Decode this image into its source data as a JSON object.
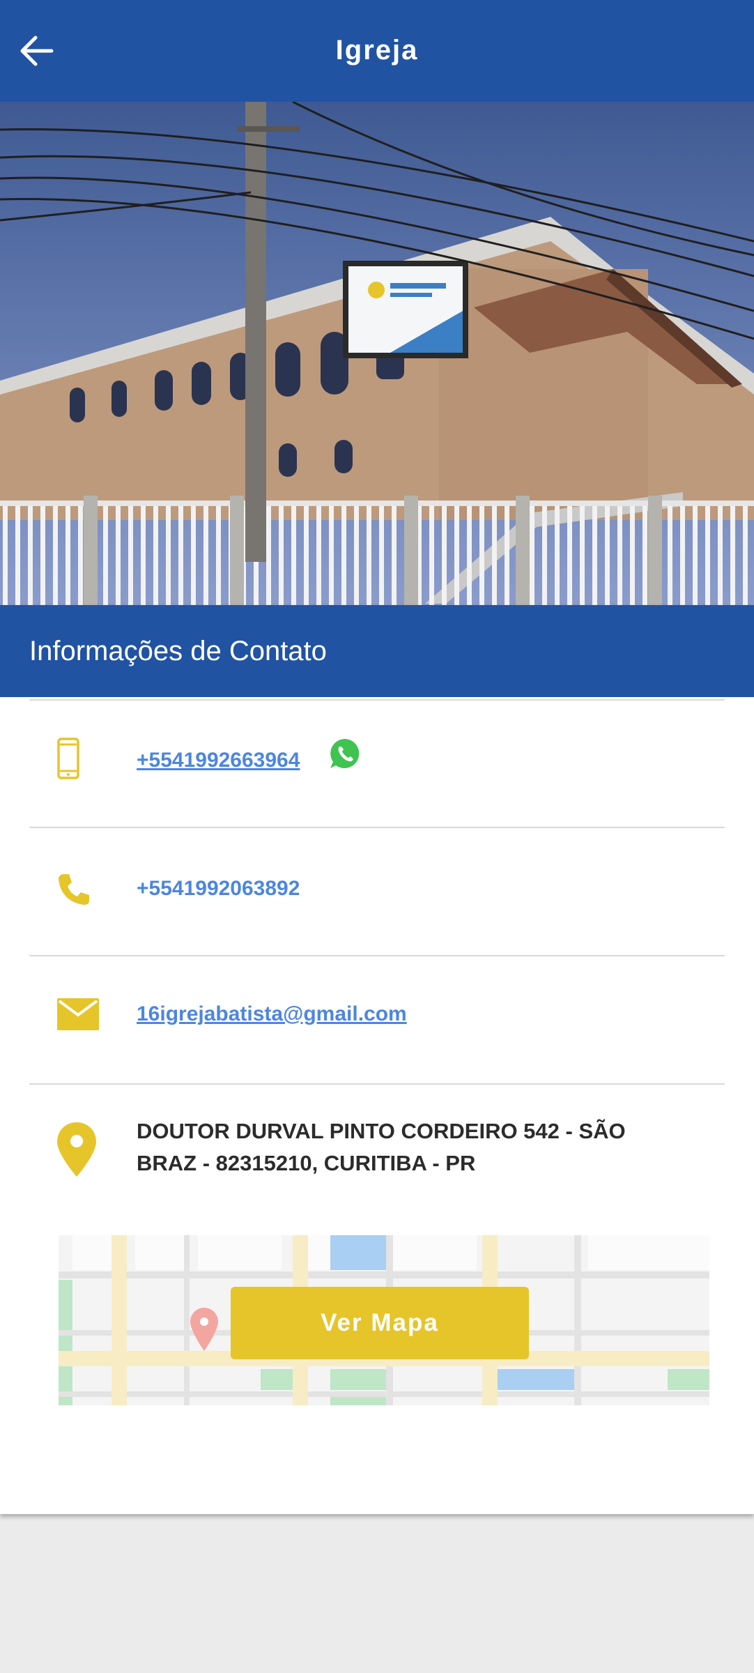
{
  "appbar": {
    "title": "Igreja"
  },
  "section": {
    "title": "Informações de Contato"
  },
  "contact": {
    "mobile": "+5541992663964 ",
    "phone": "+5541992063892",
    "email": "16igrejabatista@gmail.com",
    "address": "DOUTOR DURVAL PINTO CORDEIRO 542 - SÃO BRAZ - 82315210, CURITIBA - PR"
  },
  "map": {
    "button_label": "Ver Mapa"
  },
  "colors": {
    "primary": "#2153a3",
    "accent": "#e6c52a",
    "link": "#4c86df",
    "whatsapp": "#3fc351"
  },
  "icons": {
    "back": "arrow-left-icon",
    "mobile": "smartphone-icon",
    "whatsapp": "whatsapp-icon",
    "phone": "phone-icon",
    "email": "envelope-icon",
    "address": "map-pin-icon"
  }
}
